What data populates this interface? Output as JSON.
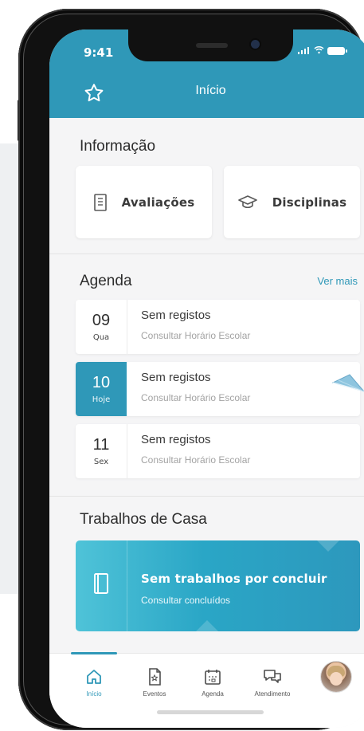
{
  "status_bar": {
    "time": "9:41",
    "network": "LTE"
  },
  "header": {
    "title": "Início",
    "accent_color": "#2f98b8"
  },
  "info": {
    "title": "Informação",
    "cards": [
      {
        "label": "Avaliações",
        "icon": "document-icon"
      },
      {
        "label": "Disciplinas",
        "icon": "graduation-cap-icon"
      }
    ]
  },
  "agenda": {
    "title": "Agenda",
    "more_label": "Ver mais",
    "items": [
      {
        "day": "09",
        "weekday": "Qua",
        "title": "Sem registos",
        "subtitle": "Consultar Horário Escolar",
        "active": false
      },
      {
        "day": "10",
        "weekday": "Hoje",
        "title": "Sem registos",
        "subtitle": "Consultar Horário Escolar",
        "active": true
      },
      {
        "day": "11",
        "weekday": "Sex",
        "title": "Sem registos",
        "subtitle": "Consultar Horário Escolar",
        "active": false
      }
    ]
  },
  "homework": {
    "title": "Trabalhos de Casa",
    "card_title": "Sem trabalhos por concluir",
    "card_subtitle": "Consultar concluídos",
    "icon": "book-icon"
  },
  "bottom_nav": {
    "items": [
      {
        "label": "Início",
        "icon": "home-icon",
        "active": true
      },
      {
        "label": "Eventos",
        "icon": "event-icon",
        "active": false
      },
      {
        "label": "Agenda",
        "icon": "calendar-icon",
        "active": false
      },
      {
        "label": "Atendimento",
        "icon": "chat-icon",
        "active": false
      }
    ],
    "profile_icon": "avatar"
  }
}
